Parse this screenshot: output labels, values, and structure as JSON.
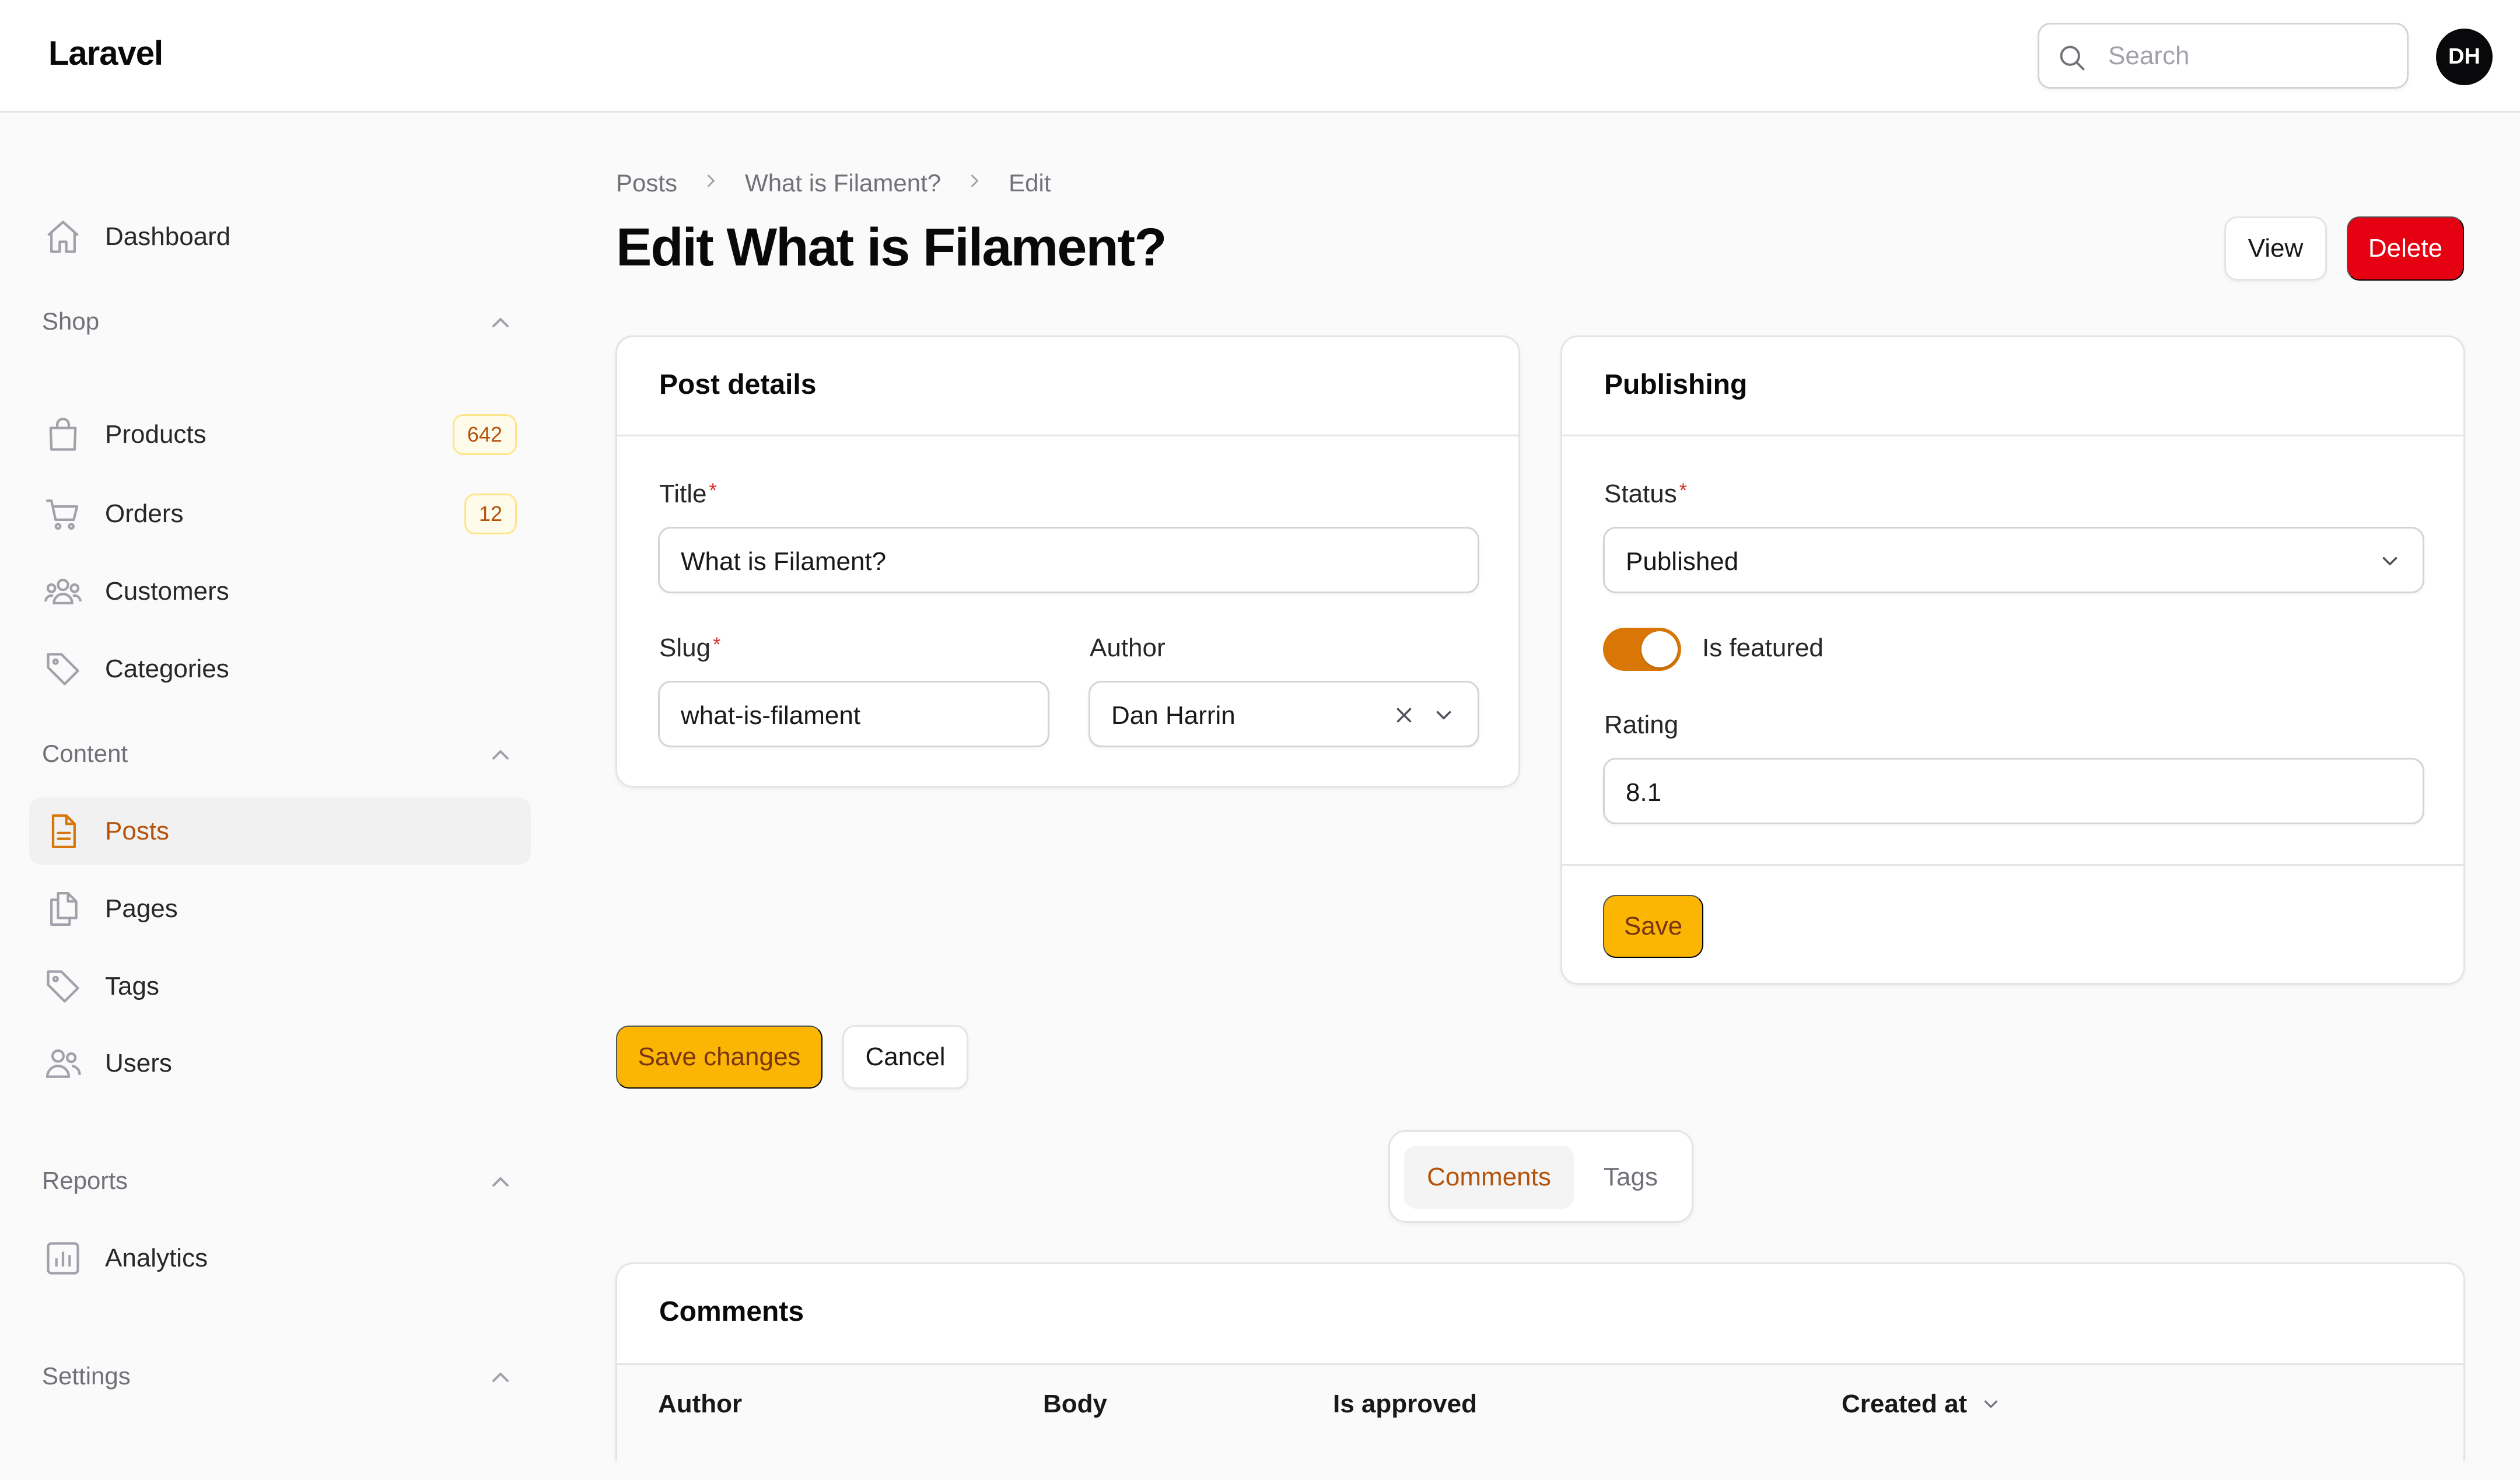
{
  "app": {
    "brand": "Laravel"
  },
  "header": {
    "search_placeholder": "Search",
    "avatar_initials": "DH"
  },
  "sidebar": {
    "dashboard": "Dashboard",
    "groups": [
      {
        "label": "Shop",
        "items": [
          {
            "label": "Products",
            "badge": "642"
          },
          {
            "label": "Orders",
            "badge": "12"
          },
          {
            "label": "Customers"
          },
          {
            "label": "Categories"
          }
        ]
      },
      {
        "label": "Content",
        "items": [
          {
            "label": "Posts",
            "active": true
          },
          {
            "label": "Pages"
          },
          {
            "label": "Tags"
          },
          {
            "label": "Users"
          }
        ]
      },
      {
        "label": "Reports",
        "items": [
          {
            "label": "Analytics"
          }
        ]
      },
      {
        "label": "Settings",
        "items": []
      }
    ]
  },
  "breadcrumb": {
    "items": [
      "Posts",
      "What is Filament?",
      "Edit"
    ]
  },
  "page": {
    "title": "Edit What is Filament?"
  },
  "actions": {
    "view_label": "View",
    "delete_label": "Delete"
  },
  "post_details": {
    "heading": "Post details",
    "title_label": "Title",
    "title_value": "What is Filament?",
    "slug_label": "Slug",
    "slug_value": "what-is-filament",
    "author_label": "Author",
    "author_value": "Dan Harrin",
    "required_mark": "*"
  },
  "publishing": {
    "heading": "Publishing",
    "status_label": "Status",
    "status_value": "Published",
    "featured_label": "Is featured",
    "featured_on": true,
    "rating_label": "Rating",
    "rating_value": "8.1",
    "save_label": "Save"
  },
  "form_actions": {
    "save_changes_label": "Save changes",
    "cancel_label": "Cancel"
  },
  "relation_tabs": [
    {
      "label": "Comments",
      "active": true
    },
    {
      "label": "Tags",
      "active": false
    }
  ],
  "comments": {
    "heading": "Comments",
    "columns": [
      "Author",
      "Body",
      "Is approved",
      "Created at"
    ]
  },
  "colors": {
    "primary": "#fbb604",
    "primary_text": "#b45309",
    "danger": "#e50012",
    "toggle_on": "#d97706"
  }
}
